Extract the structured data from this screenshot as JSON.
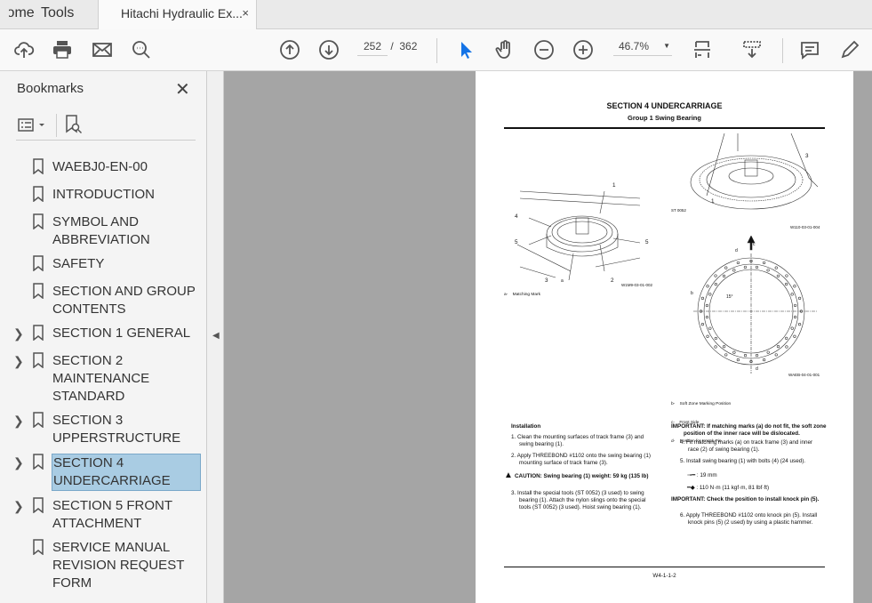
{
  "tabs": {
    "home": "Home",
    "tools": "Tools",
    "document": "Hitachi Hydraulic Ex...",
    "close": "×"
  },
  "toolbar": {
    "page_current": "252",
    "page_sep": "/",
    "page_total": "362",
    "zoom": "46.7%"
  },
  "bookmarks": {
    "title": "Bookmarks",
    "items": [
      {
        "label": "WAEBJ0-EN-00",
        "expandable": false
      },
      {
        "label": "INTRODUCTION",
        "expandable": false
      },
      {
        "label": "SYMBOL AND ABBREVIATION",
        "expandable": false
      },
      {
        "label": "SAFETY",
        "expandable": false
      },
      {
        "label": "SECTION AND GROUP CONTENTS",
        "expandable": false
      },
      {
        "label": "SECTION 1 GENERAL",
        "expandable": true
      },
      {
        "label": "SECTION 2 MAINTENANCE STANDARD",
        "expandable": true
      },
      {
        "label": "SECTION 3 UPPERSTRUCTURE",
        "expandable": true
      },
      {
        "label": "SECTION 4 UNDERCARRIAGE",
        "expandable": true,
        "selected": true
      },
      {
        "label": "SECTION 5 FRONT ATTACHMENT",
        "expandable": true
      },
      {
        "label": "SERVICE MANUAL REVISION REQUEST FORM",
        "expandable": false
      }
    ]
  },
  "document": {
    "section": "SECTION 4 UNDERCARRIAGE",
    "group": "Group 1 Swing Bearing",
    "fig1": {
      "code": "W1M9-03-01-002",
      "labels": [
        "1",
        "4",
        "5",
        "5",
        "3",
        "a",
        "2"
      ],
      "legend": "a-    Matching Mark"
    },
    "fig2": {
      "code": "W110-03-01-004",
      "labels": [
        "3",
        "ST 0052",
        "1"
      ]
    },
    "fig3": {
      "code": "WAEB-04-01-001",
      "labels": [
        "c",
        "d",
        "b",
        "15°",
        "d"
      ],
      "legend": [
        "b-    Soft Zone Marking Position",
        "c-    Front Side",
        "d-    Position for Knock Pin"
      ]
    },
    "installation_title": "Installation",
    "left_steps": [
      "1.  Clean the mounting surfaces of track frame (3) and swing bearing (1).",
      "2.  Apply THREEBOND #1102 onto the swing bearing (1) mounting surface of track frame (3)."
    ],
    "caution": "CAUTION:    Swing bearing (1) weight: 59 kg (135 lb)",
    "step3": "3.  Install the special tools (ST 0052) (3 used) to swing bearing (1). Attach the nylon slings onto the special tools (ST 0052) (3 used). Hoist swing bearing (1).",
    "important1": "IMPORTANT:    If matching marks (a) do not fit, the soft zone position of the inner race will be dislocated.",
    "step4": "4.  Fit matching marks (a) on track frame (3) and inner race (2) of swing bearing (1).",
    "step5": "5.  Install swing bearing (1) with bolts (4) (24 used).",
    "wrench": ": 19 mm",
    "torque": ": 110 N·m (11 kgf·m, 81 lbf·ft)",
    "important2": "IMPORTANT:    Check the position to install knock pin (5).",
    "step6": "6.  Apply THREEBOND #1102 onto knock pin (5). Install knock pins (5) (2 used) by using a plastic hammer.",
    "footer": "W4-1-1-2"
  }
}
